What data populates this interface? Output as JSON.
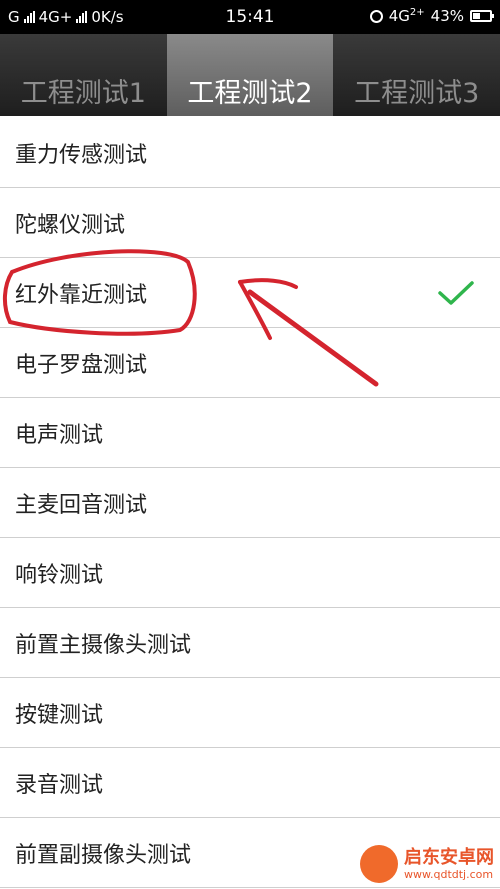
{
  "status_bar": {
    "left_text": "G",
    "network1": "4G+",
    "speed": "0K/s",
    "time": "15:41",
    "network2": "4G",
    "network2_sup": "2+",
    "battery": "43%"
  },
  "tabs": [
    {
      "label": "工程测试1",
      "active": false
    },
    {
      "label": "工程测试2",
      "active": true
    },
    {
      "label": "工程测试3",
      "active": false
    }
  ],
  "items": [
    {
      "label": "重力传感测试",
      "checked": false
    },
    {
      "label": "陀螺仪测试",
      "checked": false
    },
    {
      "label": "红外靠近测试",
      "checked": true
    },
    {
      "label": "电子罗盘测试",
      "checked": false
    },
    {
      "label": "电声测试",
      "checked": false
    },
    {
      "label": "主麦回音测试",
      "checked": false
    },
    {
      "label": "响铃测试",
      "checked": false
    },
    {
      "label": "前置主摄像头测试",
      "checked": false
    },
    {
      "label": "按键测试",
      "checked": false
    },
    {
      "label": "录音测试",
      "checked": false
    },
    {
      "label": "前置副摄像头测试",
      "checked": false
    }
  ],
  "colors": {
    "check": "#2fb54c",
    "annotation": "#d4242e"
  },
  "watermark": {
    "title": "启东安卓网",
    "url": "www.qdtdtj.com"
  }
}
